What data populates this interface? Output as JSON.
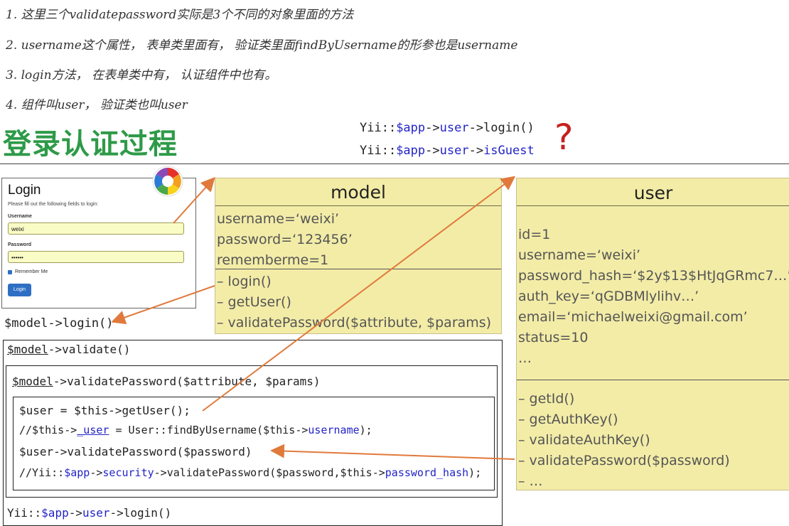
{
  "notes": [
    "1. 这里三个validatepassword实际是3个不同的对象里面的方法",
    "2. username这个属性， 表单类里面有， 验证类里面findByUsername的形参也是username",
    "3. login方法， 在表单类中有， 认证组件中也有。",
    "4. 组件叫user， 验证类也叫user"
  ],
  "title": "登录认证过程",
  "top_code": {
    "line1": {
      "prefix": "Yii::",
      "app": "$app",
      "arrow1": "->",
      "user": "user",
      "rest": "->login()"
    },
    "line2": {
      "prefix": "Yii::",
      "app": "$app",
      "arrow1": "->",
      "user": "user",
      "arrow2": "->",
      "guest": "isGuest"
    }
  },
  "question_mark": "?",
  "login_form": {
    "heading": "Login",
    "instruction": "Please fill out the following fields to login:",
    "username_label": "Username",
    "username_value": "weixi",
    "password_label": "Password",
    "password_value": "••••••",
    "remember_label": "Remember Me",
    "button_label": "Login"
  },
  "model_box": {
    "title": "model",
    "attributes": [
      "username=‘weixi’",
      "password=‘123456’",
      "rememberme=1"
    ],
    "methods": [
      "– login()",
      "– getUser()",
      "– validatePassword($attribute, $params)"
    ]
  },
  "user_box": {
    "title": "user",
    "attributes": [
      "id=1",
      "username=‘weixi’",
      "password_hash=‘$2y$13$HtJqGRmc7…’",
      "auth_key=‘qGDBMlylihv…’",
      "email=‘michaelweixi@gmail.com’",
      "status=10",
      "…"
    ],
    "methods": [
      "– getId()",
      "– getAuthKey()",
      "– validateAuthKey()",
      "– validatePassword($password)",
      "– …"
    ]
  },
  "code": {
    "model_login": "$model->login()",
    "validate": {
      "var": "$model",
      "rest": "->validate()"
    },
    "validate_password": {
      "var": "$model",
      "rest": "->validatePassword($attribute, $params)"
    },
    "get_user": "$user = $this->getUser();",
    "find_by_username": {
      "a": "//$this->",
      "b": "_user",
      "c": " = User::findByUsername($this->",
      "d": "username",
      "e": ");"
    },
    "user_validate": "$user->validatePassword($password)",
    "security_line": {
      "a": "//Yii::",
      "b": "$app",
      "c": "->",
      "d": "security",
      "e": "->validatePassword($password,$this->",
      "f": "password_hash",
      "g": ");"
    },
    "yii_login": {
      "a": "Yii::",
      "b": "$app",
      "c": "->",
      "d": "user",
      "e": "->login()"
    }
  },
  "colors": {
    "title_green": "#2e9a48",
    "arrow_orange": "#e07a3c",
    "box_yellow": "#f3eca7",
    "code_blue": "#2323c8",
    "question_red": "#c72020"
  }
}
